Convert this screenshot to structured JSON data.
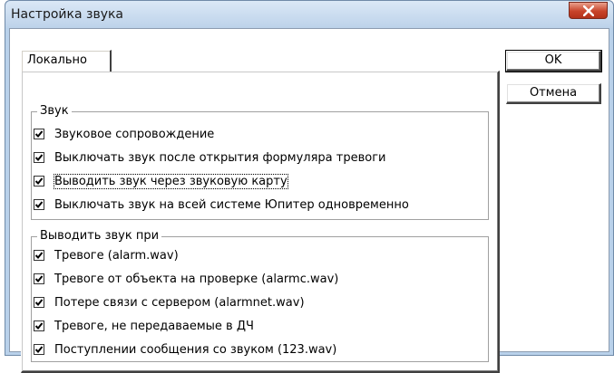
{
  "window": {
    "title": "Настройка звука"
  },
  "tabs": [
    {
      "label": "Локально",
      "active": true
    }
  ],
  "buttons": {
    "ok": "OK",
    "cancel": "Отмена"
  },
  "group_sound": {
    "title": "Звук",
    "items": [
      {
        "label": "Звуковое сопровождение",
        "checked": true
      },
      {
        "label": "Выключать звук после открытия формуляра тревоги",
        "checked": true
      },
      {
        "label": "Выводить звук через звуковую карту",
        "checked": true,
        "focused": true
      },
      {
        "label": "Выключать звук на всей системе Юпитер одновременно",
        "checked": true
      }
    ]
  },
  "group_output": {
    "title": "Выводить звук при",
    "items": [
      {
        "label": "Тревоге (alarm.wav)",
        "checked": true
      },
      {
        "label": "Тревоге от объекта на проверке (alarmc.wav)",
        "checked": true
      },
      {
        "label": "Потере связи с сервером (alarmnet.wav)",
        "checked": true
      },
      {
        "label": "Тревоге, не передаваемые в ДЧ",
        "checked": true
      },
      {
        "label": "Поступлении сообщения со звуком (123.wav)",
        "checked": true
      }
    ]
  },
  "icons": {
    "close": "close-icon",
    "checkbox_check": "checkmark-icon"
  },
  "colors": {
    "titlebar": "#bcd2ea",
    "close_button": "#c8442a"
  }
}
